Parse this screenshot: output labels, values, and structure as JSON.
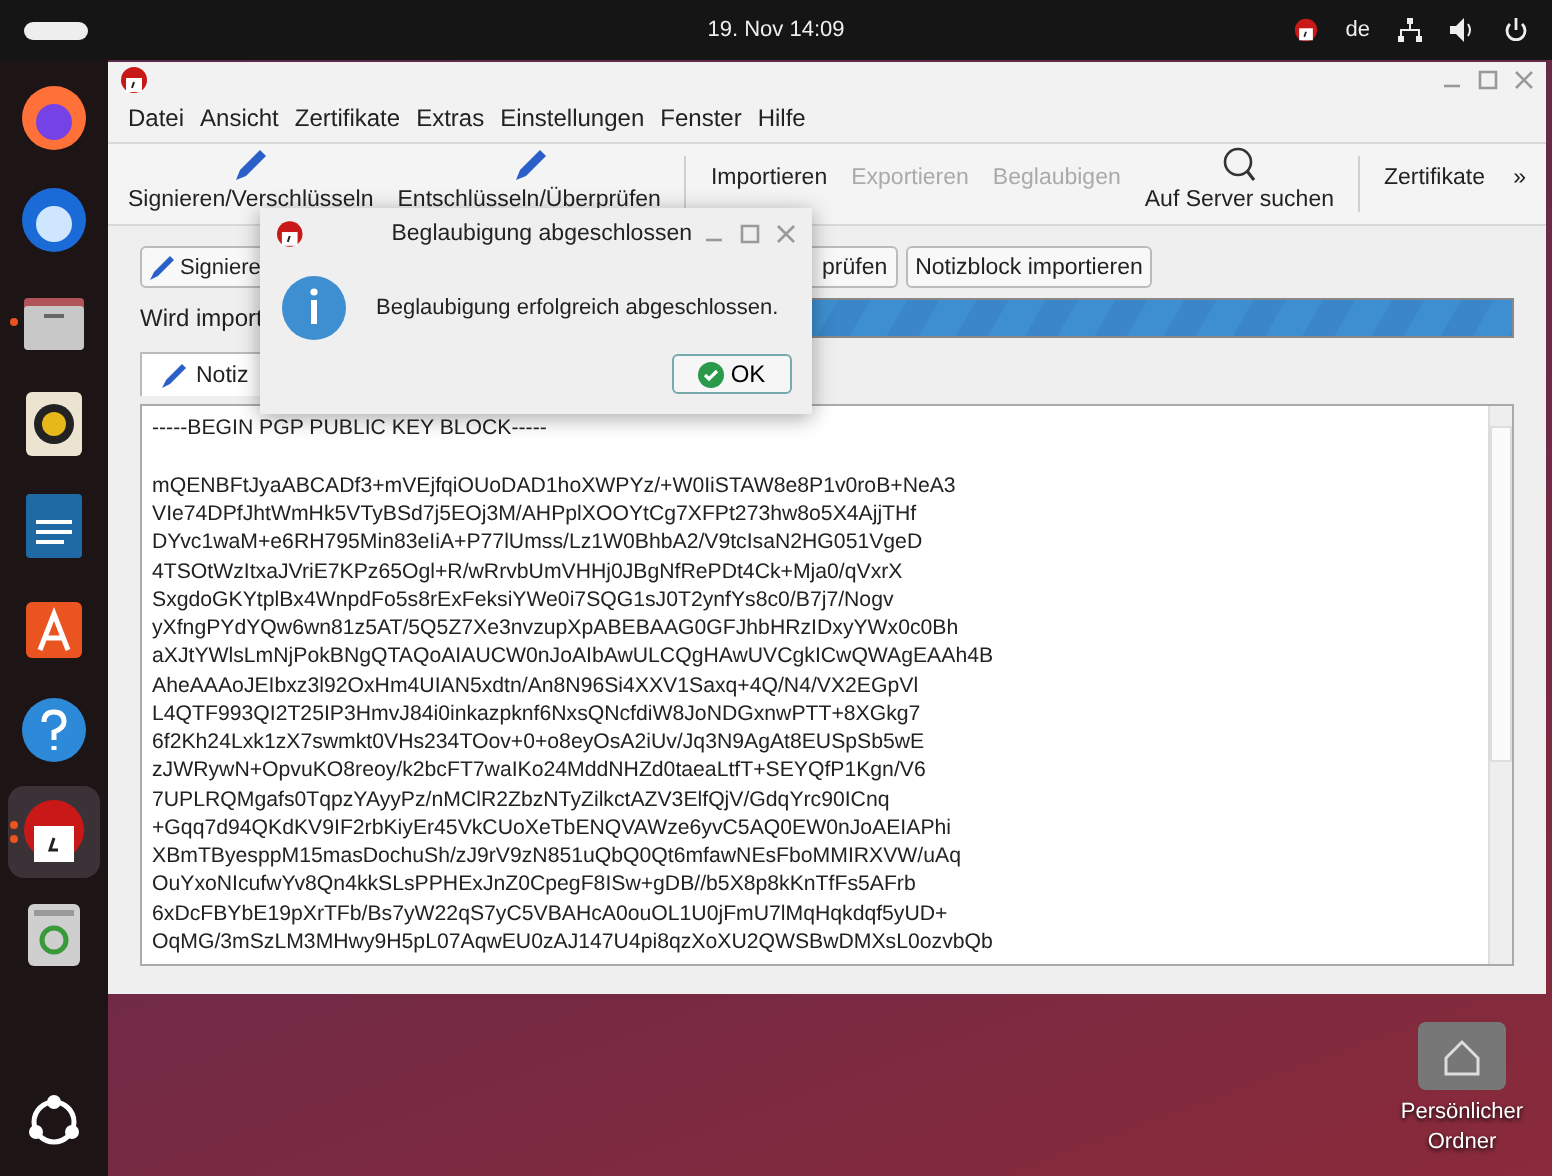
{
  "top_bar": {
    "clock": "19. Nov  14:09",
    "keyboard_layout": "de"
  },
  "dock": [
    {
      "kind": "firefox",
      "running": false,
      "selected": false
    },
    {
      "kind": "thunderbird",
      "running": false,
      "selected": false
    },
    {
      "kind": "files",
      "running": true,
      "selected": false
    },
    {
      "kind": "rhythmbox",
      "running": false,
      "selected": false
    },
    {
      "kind": "writer",
      "running": false,
      "selected": false
    },
    {
      "kind": "appcenter",
      "running": false,
      "selected": false
    },
    {
      "kind": "help",
      "running": false,
      "selected": false
    },
    {
      "kind": "kleopatra",
      "running": true,
      "selected": true
    },
    {
      "kind": "trash",
      "running": false,
      "selected": false
    }
  ],
  "window": {
    "menu": [
      "Datei",
      "Ansicht",
      "Zertifikate",
      "Extras",
      "Einstellungen",
      "Fenster",
      "Hilfe"
    ],
    "toolbar": [
      {
        "label": "Signieren/Verschlüsseln",
        "kind": "pencil",
        "disabled": false
      },
      {
        "label": "Entschlüsseln/Überprüfen",
        "kind": "pencil",
        "disabled": false
      },
      {
        "kind": "separator"
      },
      {
        "label": "Importieren",
        "kind": "text",
        "disabled": false
      },
      {
        "label": "Exportieren",
        "kind": "text",
        "disabled": true
      },
      {
        "label": "Beglaubigen",
        "kind": "text",
        "disabled": true
      },
      {
        "label": "Auf Server suchen",
        "kind": "search",
        "disabled": false
      },
      {
        "kind": "separator"
      },
      {
        "label": "Zertifikate",
        "kind": "text",
        "disabled": false
      },
      {
        "label": "»",
        "kind": "overflow"
      }
    ],
    "buttons": [
      "Signiere",
      "prüfen",
      "Notizblock importieren"
    ],
    "status": {
      "label": "Wird import",
      "level": 1
    },
    "tab": "Notiz",
    "editor_header": "-----BEGIN PGP PUBLIC KEY BLOCK-----",
    "editor_lines": [
      "mQENBFtJyaABCADf3+mVEjfqiOUoDAD1hoXWPYz/+W0IiSTAW8e8P1v0roB+NeA3",
      "VIe74DPfJhtWmHk5VTyBSd7j5EOj3M/AHPplXOOYtCg7XFPt273hw8o5X4AjjTHf",
      "DYvc1waM+e6RH795Min83eIiA+P77lUmss/Lz1W0BhbA2/V9tcIsaN2HG051VgeD",
      "4TSOtWzItxaJVriE7KPz65Ogl+R/wRrvbUmVHHj0JBgNfRePDt4Ck+Mja0/qVxrX",
      "SxgdoGKYtplBx4WnpdFo5s8rExFeksiYWe0i7SQG1sJ0T2ynfYs8c0/B7j7/Nogv",
      "yXfngPYdYQw6wn81z5AT/5Q5Z7Xe3nvzupXpABEBAAG0GFJhbHRzIDxyYWx0c0Bh",
      "aXJtYWlsLmNjPokBNgQTAQoAIAUCW0nJoAIbAwULCQgHAwUVCgkICwQWAgEAAh4B",
      "AheAAAoJEIbxz3l92OxHm4UIAN5xdtn/An8N96Si4XXV1Saxq+4Q/N4/VX2EGpVl",
      "L4QTF993QI2T25IP3HmvJ84i0inkazpknf6NxsQNcfdiW8JoNDGxnwPTT+8XGkg7",
      "6f2Kh24Lxk1zX7swmkt0VHs234TOov+0+o8eyOsA2iUv/Jq3N9AgAt8EUSpSb5wE",
      "zJWRywN+OpvuKO8reoy/k2bcFT7waIKo24MddNHZd0taeaLtfT+SEYQfP1Kgn/V6",
      "7UPLRQMgafs0TqpzYAyyPz/nMClR2ZbzNTyZilkctAZV3ElfQjV/GdqYrc90ICnq",
      "+Gqq7d94QKdKV9IF2rbKiyEr45VkCUoXeTbENQVAWze6yvC5AQ0EW0nJoAEIAPhi",
      "XBmTByesppM15masDochuSh/zJ9rV9zN851uQbQ0Qt6mfawNEsFboMMIRXVW/uAq",
      "OuYxoNIcufwYv8Qn4kkSLsPPHExJnZ0CpegF8ISw+gDB//b5X8p8kKnTfFs5AFrb",
      "6xDcFBYbE19pXrTFb/Bs7yW22qS7yC5VBAHcA0ouOL1U0jFmU7lMqHqkdqf5yUD+",
      "OqMG/3mSzLM3MHwy9H5pL07AqwEU0zAJ147U4pi8qzXoXU2QWSBwDMXsL0ozvbQb"
    ]
  },
  "dialog": {
    "title": "Beglaubigung abgeschlossen",
    "message": "Beglaubigung erfolgreich abgeschlossen.",
    "button": "OK"
  },
  "desktop_icon": {
    "label": "Persönlicher Ordner"
  }
}
